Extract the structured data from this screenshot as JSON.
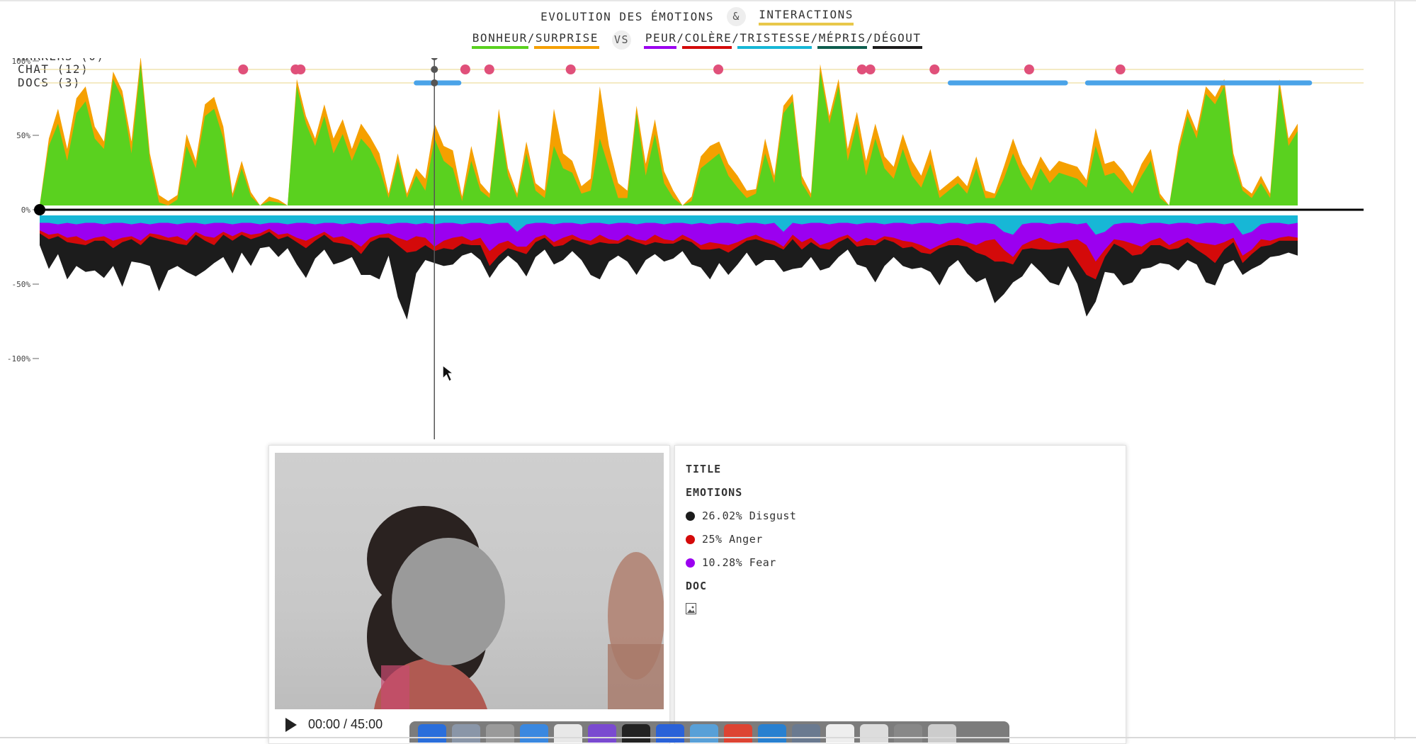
{
  "header": {
    "title_left": "EVOLUTION DES ÉMOTIONS",
    "amp": "&",
    "title_right": "INTERACTIONS",
    "positive_label": "BONHEUR/SURPRISE",
    "vs": "VS",
    "negative_label": "PEUR/COLÈRE/TRISTESSE/MÉPRIS/DÉGOUT"
  },
  "colors": {
    "happiness": "#5ad11f",
    "surprise": "#f5a000",
    "fear": "#9b00f0",
    "anger": "#d40a0a",
    "sadness": "#17b7d6",
    "contempt": "#0e5e4e",
    "disgust": "#1c1c1c",
    "chat_marker": "#e0507a",
    "doc_bar": "#4aa3e8",
    "track_line": "#e8d48a",
    "interactions_underline": "#e8c84a"
  },
  "tracks": [
    {
      "label": "MARKERS (0)"
    },
    {
      "label": "CHAT (12)"
    },
    {
      "label": "DOCS (3)"
    }
  ],
  "chart_data": {
    "type": "area",
    "y_ticks": [
      "100%",
      "50%",
      "0%",
      "-50%",
      "-100%"
    ],
    "ylim": [
      -100,
      100
    ],
    "xlim": [
      0,
      2700
    ],
    "cursor_x": 805,
    "chat_markers_x": [
      415,
      522,
      532,
      868,
      917,
      1083,
      1384,
      1677,
      1694,
      1825,
      2018,
      2204
    ],
    "doc_spans": [
      [
        768,
        855
      ],
      [
        1857,
        2092
      ],
      [
        2137,
        2590
      ]
    ],
    "positive_series": [
      {
        "name": "BONHEUR",
        "values": [
          0,
          40,
          55,
          30,
          62,
          70,
          45,
          38,
          85,
          72,
          35,
          95,
          30,
          2,
          0,
          4,
          40,
          25,
          60,
          65,
          45,
          5,
          25,
          6,
          0,
          3,
          2,
          0,
          80,
          55,
          40,
          60,
          35,
          48,
          30,
          45,
          38,
          25,
          5,
          30,
          5,
          20,
          10,
          45,
          30,
          25,
          3,
          30,
          10,
          5,
          60,
          20,
          5,
          35,
          10,
          5,
          40,
          25,
          22,
          8,
          10,
          45,
          25,
          5,
          5,
          62,
          20,
          48,
          15,
          5,
          0,
          3,
          25,
          30,
          35,
          20,
          12,
          5,
          8,
          35,
          15,
          62,
          70,
          15,
          5,
          90,
          55,
          80,
          30,
          55,
          20,
          45,
          25,
          18,
          38,
          20,
          12,
          28,
          5,
          10,
          15,
          8,
          25,
          5,
          5,
          18,
          35,
          20,
          10,
          25,
          15,
          22,
          20,
          18,
          12,
          40,
          20,
          22,
          15,
          8,
          20,
          30,
          5,
          0,
          35,
          60,
          45,
          75,
          68,
          80,
          30,
          10,
          5,
          15,
          5,
          80,
          40,
          50
        ]
      },
      {
        "name": "SURPRISE",
        "values": [
          0,
          5,
          10,
          8,
          10,
          10,
          8,
          5,
          5,
          5,
          8,
          5,
          5,
          5,
          3,
          3,
          8,
          5,
          8,
          8,
          8,
          3,
          5,
          3,
          0,
          3,
          2,
          0,
          5,
          5,
          5,
          8,
          10,
          10,
          8,
          10,
          8,
          10,
          3,
          5,
          3,
          5,
          8,
          10,
          10,
          12,
          3,
          10,
          5,
          3,
          5,
          5,
          3,
          8,
          5,
          5,
          25,
          10,
          8,
          5,
          8,
          35,
          15,
          10,
          5,
          5,
          8,
          10,
          8,
          5,
          0,
          3,
          8,
          10,
          8,
          8,
          8,
          5,
          3,
          10,
          5,
          5,
          5,
          5,
          3,
          5,
          5,
          5,
          8,
          8,
          10,
          10,
          8,
          8,
          10,
          10,
          8,
          10,
          5,
          5,
          5,
          5,
          8,
          5,
          3,
          8,
          10,
          8,
          8,
          8,
          8,
          8,
          8,
          8,
          5,
          12,
          8,
          8,
          8,
          5,
          8,
          8,
          3,
          0,
          5,
          5,
          5,
          5,
          5,
          5,
          5,
          3,
          3,
          5,
          3,
          5,
          5,
          5
        ]
      }
    ],
    "negative_series": [
      {
        "name": "MÉPRIS",
        "values": [
          3,
          3,
          3,
          3,
          3,
          3,
          3,
          3,
          3,
          3,
          3,
          3,
          3,
          3,
          3,
          3,
          3,
          3,
          3,
          3,
          3,
          3,
          3,
          3,
          3,
          3,
          3,
          3,
          3,
          3,
          3,
          3,
          3,
          3,
          3,
          3,
          3,
          3,
          3,
          3,
          3,
          3,
          3,
          3,
          3,
          3,
          3,
          3,
          3,
          3,
          3,
          3,
          3,
          3,
          3,
          3,
          3,
          3,
          3,
          3,
          3,
          3,
          3,
          3,
          3,
          3,
          3,
          3,
          3,
          3,
          3,
          3,
          3,
          3,
          3,
          3,
          3,
          3,
          3,
          3,
          3,
          3,
          3,
          3,
          3,
          3,
          3,
          3,
          3,
          3,
          3,
          3,
          3,
          3,
          3,
          3,
          3,
          3,
          3,
          3,
          3,
          3,
          3,
          3,
          3,
          3,
          3,
          3,
          3,
          3,
          3,
          3,
          3,
          3,
          3,
          3,
          3,
          3,
          3,
          3,
          3,
          3,
          3,
          3,
          3,
          3,
          3,
          3,
          3,
          3,
          3,
          3,
          3,
          3,
          3,
          3,
          3,
          3
        ]
      },
      {
        "name": "TRISTESSE",
        "values": [
          2,
          2,
          3,
          2,
          3,
          2,
          2,
          3,
          2,
          2,
          3,
          2,
          3,
          2,
          2,
          3,
          2,
          2,
          3,
          2,
          2,
          3,
          2,
          2,
          3,
          2,
          2,
          3,
          2,
          2,
          3,
          2,
          2,
          3,
          2,
          3,
          2,
          2,
          3,
          2,
          2,
          3,
          2,
          3,
          2,
          2,
          3,
          2,
          2,
          3,
          2,
          2,
          8,
          3,
          2,
          2,
          3,
          2,
          2,
          3,
          2,
          2,
          3,
          2,
          2,
          3,
          2,
          2,
          3,
          2,
          2,
          3,
          2,
          3,
          2,
          2,
          3,
          2,
          2,
          3,
          2,
          8,
          2,
          3,
          2,
          2,
          3,
          2,
          2,
          3,
          2,
          2,
          3,
          2,
          2,
          3,
          2,
          2,
          3,
          2,
          2,
          3,
          2,
          2,
          3,
          8,
          10,
          3,
          2,
          2,
          3,
          2,
          2,
          3,
          2,
          10,
          8,
          3,
          2,
          2,
          3,
          2,
          2,
          3,
          2,
          2,
          3,
          2,
          2,
          3,
          2,
          10,
          8,
          3,
          2,
          2,
          3,
          2
        ]
      },
      {
        "name": "PEUR",
        "values": [
          5,
          8,
          6,
          10,
          8,
          12,
          10,
          8,
          12,
          10,
          8,
          12,
          6,
          8,
          10,
          8,
          12,
          6,
          8,
          10,
          6,
          8,
          6,
          8,
          6,
          4,
          8,
          6,
          10,
          12,
          8,
          6,
          10,
          8,
          12,
          15,
          10,
          8,
          6,
          10,
          12,
          8,
          10,
          15,
          12,
          10,
          8,
          12,
          10,
          18,
          14,
          12,
          10,
          15,
          10,
          8,
          12,
          10,
          8,
          10,
          12,
          8,
          10,
          12,
          8,
          10,
          12,
          8,
          10,
          12,
          8,
          10,
          15,
          12,
          14,
          15,
          12,
          10,
          8,
          10,
          12,
          10,
          8,
          12,
          10,
          15,
          12,
          10,
          8,
          12,
          10,
          12,
          8,
          10,
          12,
          12,
          15,
          18,
          14,
          12,
          10,
          12,
          15,
          12,
          10,
          12,
          15,
          14,
          12,
          10,
          12,
          14,
          12,
          10,
          15,
          18,
          12,
          10,
          12,
          14,
          15,
          12,
          10,
          14,
          12,
          10,
          12,
          14,
          15,
          12,
          10,
          14,
          12,
          10,
          12,
          10,
          8,
          10
        ]
      },
      {
        "name": "COLÈRE",
        "values": [
          2,
          3,
          2,
          3,
          5,
          3,
          2,
          3,
          5,
          3,
          2,
          3,
          2,
          3,
          2,
          5,
          3,
          2,
          3,
          5,
          2,
          3,
          2,
          3,
          2,
          2,
          3,
          2,
          3,
          5,
          3,
          2,
          3,
          5,
          3,
          5,
          3,
          2,
          3,
          5,
          8,
          10,
          5,
          3,
          5,
          8,
          5,
          3,
          5,
          10,
          8,
          5,
          3,
          5,
          3,
          2,
          3,
          5,
          3,
          2,
          3,
          5,
          3,
          2,
          3,
          2,
          3,
          5,
          3,
          2,
          3,
          2,
          3,
          5,
          3,
          5,
          3,
          2,
          3,
          2,
          3,
          2,
          3,
          5,
          3,
          2,
          5,
          3,
          2,
          3,
          5,
          3,
          2,
          3,
          5,
          3,
          5,
          3,
          2,
          3,
          5,
          3,
          5,
          10,
          15,
          8,
          5,
          3,
          5,
          8,
          5,
          3,
          5,
          15,
          20,
          12,
          5,
          3,
          5,
          8,
          5,
          3,
          5,
          3,
          5,
          3,
          5,
          8,
          12,
          5,
          3,
          5,
          3,
          5,
          3,
          2,
          3,
          2
        ]
      },
      {
        "name": "DÉGOUT",
        "values": [
          8,
          20,
          12,
          25,
          15,
          18,
          20,
          25,
          12,
          30,
          15,
          12,
          20,
          35,
          20,
          15,
          18,
          28,
          20,
          12,
          15,
          22,
          12,
          18,
          8,
          10,
          12,
          8,
          15,
          20,
          12,
          10,
          15,
          12,
          8,
          14,
          22,
          28,
          12,
          35,
          45,
          15,
          10,
          8,
          12,
          10,
          8,
          5,
          10,
          8,
          6,
          5,
          8,
          15,
          10,
          8,
          12,
          10,
          8,
          12,
          20,
          25,
          12,
          8,
          15,
          22,
          10,
          8,
          12,
          10,
          8,
          15,
          12,
          20,
          10,
          15,
          12,
          8,
          18,
          12,
          10,
          15,
          20,
          12,
          10,
          15,
          12,
          10,
          8,
          12,
          15,
          25,
          18,
          10,
          12,
          15,
          10,
          12,
          25,
          15,
          10,
          18,
          20,
          15,
          28,
          22,
          12,
          18,
          10,
          15,
          22,
          25,
          12,
          15,
          28,
          15,
          10,
          20,
          25,
          18,
          10,
          15,
          12,
          10,
          15,
          12,
          10,
          18,
          15,
          10,
          12,
          8,
          10,
          12,
          8,
          10,
          8,
          10
        ]
      }
    ]
  },
  "info": {
    "title_label": "TITLE",
    "emotions_label": "EMOTIONS",
    "emotions": [
      {
        "text": "26.02% Disgust",
        "color": "#1c1c1c"
      },
      {
        "text": "25% Anger",
        "color": "#d40a0a"
      },
      {
        "text": "10.28% Fear",
        "color": "#9b00f0"
      }
    ],
    "doc_label": "DOC",
    "doc_icon": "image-icon"
  },
  "player": {
    "time": "00:00 / 45:00",
    "icon": "play-icon"
  }
}
